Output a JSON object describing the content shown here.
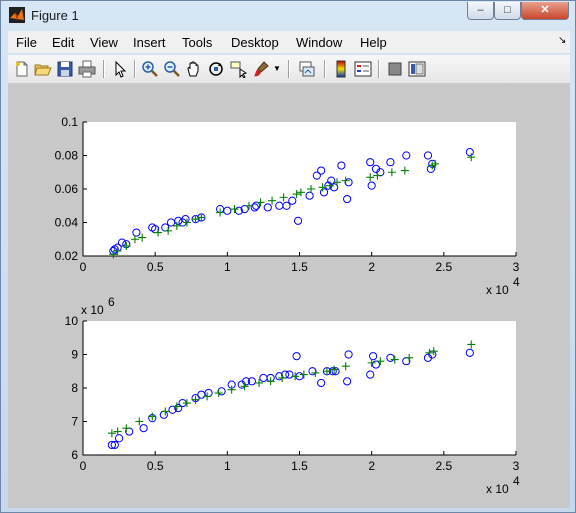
{
  "window": {
    "title": "Figure 1",
    "minimize_label": "–",
    "maximize_label": "□",
    "close_label": "✕"
  },
  "menubar": {
    "items": [
      {
        "label": "File"
      },
      {
        "label": "Edit"
      },
      {
        "label": "View"
      },
      {
        "label": "Insert"
      },
      {
        "label": "Tools"
      },
      {
        "label": "Desktop"
      },
      {
        "label": "Window"
      },
      {
        "label": "Help"
      }
    ]
  },
  "toolbar": {
    "icons": [
      "new-figure-icon",
      "open-file-icon",
      "save-icon",
      "print-icon",
      "edit-plot-icon",
      "zoom-in-icon",
      "zoom-out-icon",
      "pan-icon",
      "rotate-3d-icon",
      "data-cursor-icon",
      "brush-icon",
      "link-plot-icon",
      "colorbar-icon",
      "legend-icon",
      "hide-plot-tools-icon",
      "show-plot-tools-icon"
    ]
  },
  "chart_data": [
    {
      "type": "scatter",
      "xlim": [
        0,
        30000
      ],
      "ylim": [
        0.02,
        0.1
      ],
      "x_ticks": [
        "0",
        "0.5",
        "1",
        "1.5",
        "2",
        "2.5",
        "3"
      ],
      "y_ticks": [
        "0.02",
        "0.04",
        "0.06",
        "0.08",
        "0.1"
      ],
      "x_multiplier": "x 10",
      "x_multiplier_exp": "4",
      "grid": false,
      "series": [
        {
          "marker": "circle",
          "color": "#0000ff",
          "x": [
            2100,
            2200,
            2400,
            2700,
            3000,
            3700,
            4800,
            5000,
            5700,
            6100,
            6600,
            6900,
            7100,
            7800,
            8200,
            9500,
            10000,
            10800,
            11200,
            11900,
            12000,
            12800,
            13600,
            14100,
            14500,
            14900,
            15700,
            16200,
            16500,
            16700,
            17000,
            17200,
            17400,
            17900,
            18300,
            18400,
            19900,
            20000,
            20300,
            20600,
            21300,
            22400,
            23900,
            24100,
            24200,
            26800
          ],
          "y": [
            0.023,
            0.024,
            0.025,
            0.028,
            0.027,
            0.034,
            0.037,
            0.036,
            0.037,
            0.04,
            0.041,
            0.04,
            0.042,
            0.042,
            0.043,
            0.048,
            0.047,
            0.047,
            0.048,
            0.049,
            0.05,
            0.049,
            0.05,
            0.05,
            0.053,
            0.041,
            0.056,
            0.068,
            0.071,
            0.058,
            0.062,
            0.065,
            0.061,
            0.074,
            0.054,
            0.064,
            0.076,
            0.062,
            0.072,
            0.07,
            0.076,
            0.08,
            0.08,
            0.072,
            0.075,
            0.082
          ]
        },
        {
          "marker": "plus",
          "color": "#008000",
          "x": [
            2100,
            2400,
            3000,
            3600,
            4100,
            5200,
            5900,
            6500,
            7200,
            7800,
            8200,
            9500,
            10500,
            11500,
            12300,
            13100,
            13900,
            14800,
            15100,
            15800,
            16600,
            17100,
            17600,
            18200,
            19900,
            20400,
            21400,
            22300,
            24200,
            24400,
            26900
          ],
          "y": [
            0.021,
            0.023,
            0.026,
            0.03,
            0.031,
            0.034,
            0.035,
            0.038,
            0.04,
            0.042,
            0.043,
            0.046,
            0.048,
            0.05,
            0.052,
            0.053,
            0.055,
            0.057,
            0.058,
            0.06,
            0.061,
            0.062,
            0.064,
            0.065,
            0.067,
            0.068,
            0.07,
            0.071,
            0.074,
            0.075,
            0.079
          ]
        }
      ]
    },
    {
      "type": "scatter",
      "xlim": [
        0,
        30000
      ],
      "ylim": [
        6,
        10
      ],
      "x_ticks": [
        "0",
        "0.5",
        "1",
        "1.5",
        "2",
        "2.5",
        "3"
      ],
      "y_ticks": [
        "6",
        "7",
        "8",
        "9",
        "10"
      ],
      "x_multiplier": "x 10",
      "x_multiplier_exp": "4",
      "y_multiplier": "x 10",
      "y_multiplier_exp": "6",
      "grid": false,
      "series": [
        {
          "marker": "circle",
          "color": "#0000ff",
          "x": [
            2000,
            2200,
            2500,
            3200,
            4200,
            4800,
            5600,
            6200,
            6600,
            6900,
            7800,
            8200,
            8700,
            9600,
            10300,
            11000,
            11300,
            11700,
            12500,
            13000,
            13600,
            14000,
            14300,
            14800,
            15000,
            15900,
            16500,
            16900,
            17300,
            17500,
            18300,
            18400,
            19900,
            20100,
            20300,
            21300,
            22400,
            23900,
            24200,
            26800
          ],
          "y": [
            6.3,
            6.3,
            6.5,
            6.7,
            6.8,
            7.1,
            7.2,
            7.35,
            7.4,
            7.55,
            7.7,
            7.8,
            7.85,
            7.9,
            8.1,
            8.1,
            8.2,
            8.2,
            8.3,
            8.3,
            8.35,
            8.4,
            8.4,
            8.95,
            8.35,
            8.5,
            8.15,
            8.5,
            8.5,
            8.5,
            8.2,
            9.0,
            8.4,
            8.95,
            8.7,
            8.9,
            8.8,
            8.9,
            9.0,
            9.05
          ]
        },
        {
          "marker": "plus",
          "color": "#008000",
          "x": [
            2000,
            2400,
            3000,
            3900,
            4800,
            5700,
            6500,
            7200,
            7800,
            8600,
            9400,
            10300,
            11200,
            12200,
            13000,
            13800,
            14700,
            15300,
            16100,
            16900,
            17400,
            18200,
            20000,
            20600,
            21600,
            22600,
            24000,
            24300,
            26900
          ],
          "y": [
            6.65,
            6.7,
            6.8,
            7.0,
            7.15,
            7.3,
            7.45,
            7.55,
            7.65,
            7.75,
            7.85,
            7.95,
            8.05,
            8.15,
            8.2,
            8.3,
            8.35,
            8.4,
            8.45,
            8.5,
            8.55,
            8.65,
            8.75,
            8.8,
            8.85,
            8.9,
            9.05,
            9.1,
            9.3
          ]
        }
      ]
    }
  ]
}
